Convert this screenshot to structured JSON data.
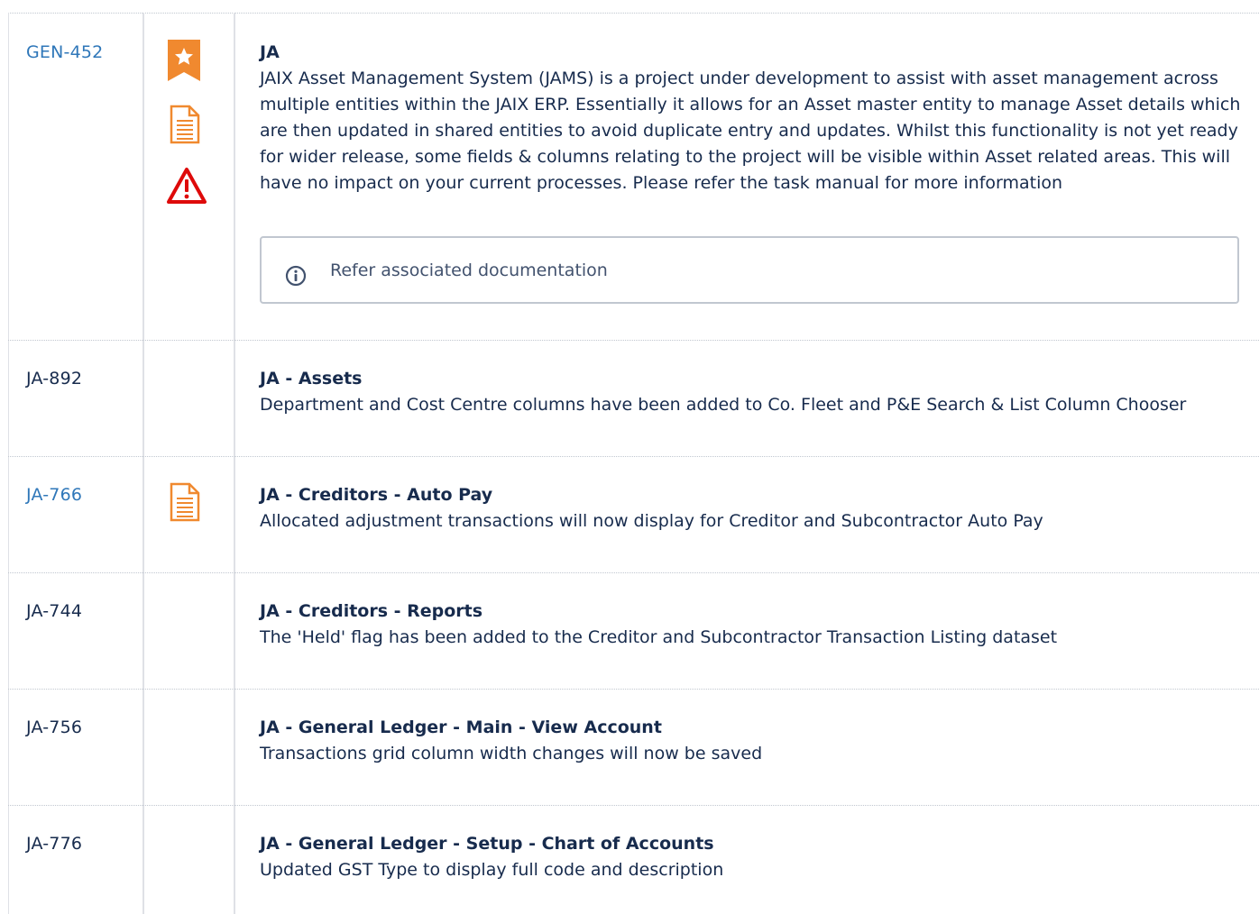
{
  "rows": [
    {
      "ticket": "GEN-452",
      "title": "JA",
      "desc": "JAIX Asset Management System (JAMS) is a project under development to assist with asset management across multiple entities within the JAIX ERP.  Essentially it allows for an Asset master entity to manage Asset details which are then updated in shared entities to avoid duplicate entry and updates.   Whilst this functionality is not yet ready for wider release, some fields & columns relating to the project will be visible within Asset related areas.  This will have no impact on your current processes.   Please refer the task manual for more information",
      "icons": [
        "star-bookmark-icon",
        "document-icon",
        "warning-icon"
      ],
      "panel": "Refer associated documentation"
    },
    {
      "ticket": "JA-892",
      "title": "JA - Assets",
      "desc": "Department and Cost Centre columns have been added to Co. Fleet and P&E Search & List Column Chooser"
    },
    {
      "ticket": "JA-766",
      "title": "JA - Creditors - Auto Pay",
      "desc": "Allocated adjustment transactions will now display for Creditor and Subcontractor Auto Pay",
      "icons": [
        "document-icon"
      ]
    },
    {
      "ticket": "JA-744",
      "title": "JA - Creditors - Reports",
      "desc": "The 'Held' flag has been added to the Creditor and Subcontractor Transaction Listing dataset"
    },
    {
      "ticket": "JA-756",
      "title": "JA - General Ledger - Main - View Account",
      "desc": "Transactions grid column width changes will now be saved"
    },
    {
      "ticket": "JA-776",
      "title": "JA - General Ledger - Setup - Chart of Accounts",
      "desc": "Updated GST Type to display full code and description"
    }
  ],
  "colors": {
    "link": "#2f77b9",
    "text": "#172b4d",
    "accent_orange": "#f0892f",
    "warning_red": "#de0a0a",
    "border": "#dfe1e6"
  }
}
